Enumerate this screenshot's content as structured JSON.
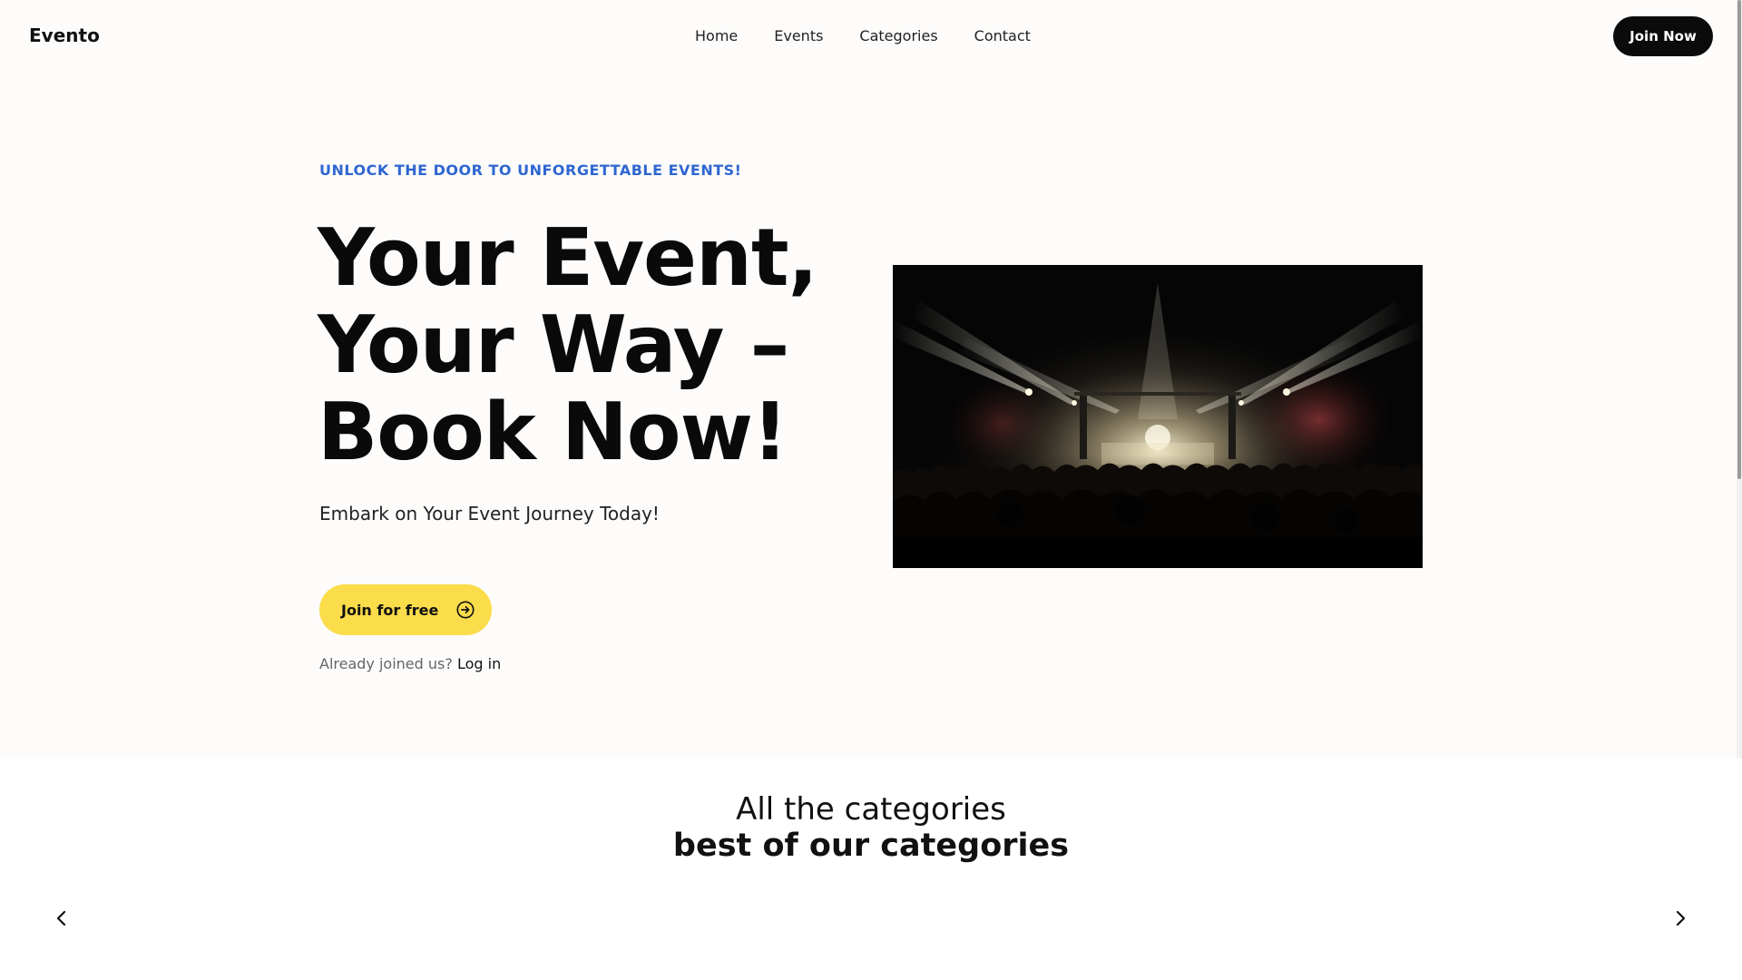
{
  "header": {
    "logo": "Evento",
    "nav": [
      "Home",
      "Events",
      "Categories",
      "Contact"
    ],
    "cta_label": "Join Now"
  },
  "hero": {
    "eyebrow": "UNLOCK THE DOOR TO UNFORGETTABLE EVENTS!",
    "title_lines": [
      "Your Event,",
      "Your Way –",
      "Book Now!"
    ],
    "subtitle": "Embark on Your Event Journey Today!",
    "cta_label": "Join for free",
    "login_prompt": "Already joined us?",
    "login_link": "Log in",
    "image_icon": "concert-crowd-image"
  },
  "categories": {
    "kicker": "All the categories",
    "title": "best of our categories"
  },
  "colors": {
    "accent_blue": "#2f66d0",
    "cta_yellow": "#fbdc4a",
    "dark": "#0b0b0b",
    "background": "#fdfcfb"
  }
}
